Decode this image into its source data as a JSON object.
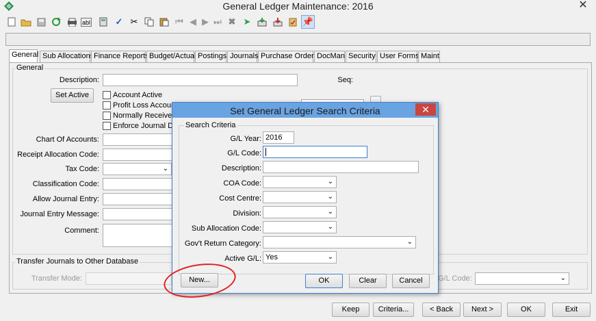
{
  "window": {
    "title": "General Ledger Maintenance: 2016"
  },
  "icons": {
    "app": "gl-app-icon",
    "close": "close-icon",
    "toolbar": [
      "new-icon",
      "open-icon",
      "save-icon",
      "refresh-icon",
      "print-icon",
      "abl-icon",
      "calculator-icon",
      "spellcheck-icon",
      "cut-icon",
      "copy-icon",
      "paste-icon",
      "first-icon",
      "prev-icon",
      "next-icon",
      "last-icon",
      "delete-icon",
      "run-icon",
      "export-icon",
      "download-icon",
      "clipboard-icon",
      "pin-icon"
    ]
  },
  "tabs": [
    "General",
    "Sub Allocations",
    "Finance Reports",
    "Budget/Actual",
    "Postings",
    "Journals",
    "Purchase Orders",
    "DocMan",
    "Security",
    "User Forms",
    "Maint"
  ],
  "general": {
    "group_label": "General",
    "description_label": "Description:",
    "seq_label": "Seq:",
    "set_active_button": "Set Active",
    "checkboxes": [
      "Account Active",
      "Profit Loss Account",
      "Normally Receives C",
      "Enforce Journal Desc"
    ],
    "chart_of_accounts_label": "Chart Of Accounts:",
    "receipt_allocation_label": "Receipt Allocation Code:",
    "tax_code_label": "Tax Code:",
    "classification_label": "Classification Code:",
    "allow_journal_label": "Allow Journal Entry:",
    "journal_msg_label": "Journal Entry Message:",
    "comment_label": "Comment:"
  },
  "transfer": {
    "group_label": "Transfer Journals to Other Database",
    "mode_label": "Transfer Mode:",
    "gl_code_label": "G/L Code:"
  },
  "bottom_buttons": {
    "keep": "Keep",
    "criteria": "Criteria...",
    "back": "< Back",
    "next": "Next >",
    "ok": "OK",
    "exit": "Exit"
  },
  "dialog": {
    "title": "Set General Ledger Search Criteria",
    "group_label": "Search Criteria",
    "fields": {
      "gl_year_label": "G/L Year:",
      "gl_year_value": "2016",
      "gl_code_label": "G/L Code:",
      "description_label": "Description:",
      "coa_label": "COA Code:",
      "cost_centre_label": "Cost Centre:",
      "division_label": "Division:",
      "sub_alloc_label": "Sub Allocation Code:",
      "govt_label": "Gov't Return Category:",
      "active_label": "Active G/L:",
      "active_value": "Yes"
    },
    "buttons": {
      "new": "New...",
      "ok": "OK",
      "clear": "Clear",
      "cancel": "Cancel"
    }
  }
}
